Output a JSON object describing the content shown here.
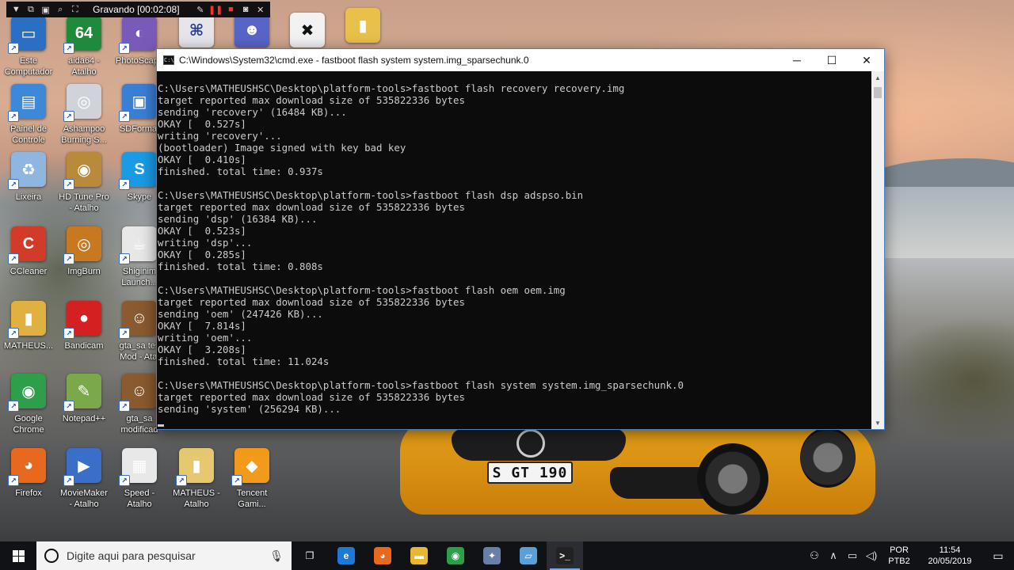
{
  "recorder": {
    "status": "Gravando [00:02:08]"
  },
  "desktop_icons": [
    {
      "id": "este-computador",
      "label": "Este\nComputador",
      "icon": "computer-icon",
      "color": "#2b6fc4",
      "glyph": "▭"
    },
    {
      "id": "aida64",
      "label": "aida64 -\nAtalho",
      "icon": "aida64-icon",
      "color": "#1f8a3a",
      "glyph": "64"
    },
    {
      "id": "photoscape",
      "label": "PhotoScape",
      "icon": "photoscape-icon",
      "color": "#7a5ab8",
      "glyph": "◐"
    },
    {
      "id": "painel",
      "label": "Painel de\nControle",
      "icon": "control-panel-icon",
      "color": "#3d88d8",
      "glyph": "▤"
    },
    {
      "id": "ashampoo",
      "label": "Ashampoo\nBurning S...",
      "icon": "ashampoo-icon",
      "color": "#d0d4da",
      "glyph": "◎"
    },
    {
      "id": "sdformat",
      "label": "SDFormat",
      "icon": "sdformatter-icon",
      "color": "#3a7fd6",
      "glyph": "▣"
    },
    {
      "id": "lixeira",
      "label": "Lixeira",
      "icon": "recycle-bin-icon",
      "color": "#8fb6de",
      "glyph": "♻"
    },
    {
      "id": "hdtune",
      "label": "HD Tune Pro\n- Atalho",
      "icon": "hdtune-icon",
      "color": "#b88a3a",
      "glyph": "◉"
    },
    {
      "id": "skype",
      "label": "Skype",
      "icon": "skype-icon",
      "color": "#1a9be6",
      "glyph": "S"
    },
    {
      "id": "ccleaner",
      "label": "CCleaner",
      "icon": "ccleaner-icon",
      "color": "#d23a2a",
      "glyph": "C"
    },
    {
      "id": "imgburn",
      "label": "ImgBurn",
      "icon": "imgburn-icon",
      "color": "#c87820",
      "glyph": "◎"
    },
    {
      "id": "shiginima",
      "label": "Shiginim\nLaunch...",
      "icon": "java-icon",
      "color": "#e8e8e8",
      "glyph": "☕"
    },
    {
      "id": "matheus1",
      "label": "MATHEUS...",
      "icon": "user-folder-icon",
      "color": "#e0b040",
      "glyph": "▮"
    },
    {
      "id": "bandicam",
      "label": "Bandicam",
      "icon": "bandicam-icon",
      "color": "#d42020",
      "glyph": "●"
    },
    {
      "id": "gtasa-test",
      "label": "gta_sa tes\nMod - Atal",
      "icon": "gta-icon",
      "color": "#8a5a30",
      "glyph": "☺"
    },
    {
      "id": "chrome",
      "label": "Google\nChrome",
      "icon": "chrome-icon",
      "color": "#2f9e4a",
      "glyph": "◉"
    },
    {
      "id": "notepadpp",
      "label": "Notepad++",
      "icon": "notepadpp-icon",
      "color": "#7aa84a",
      "glyph": "✎"
    },
    {
      "id": "gtasa-mod",
      "label": "gta_sa\nmodificad",
      "icon": "gta-icon",
      "color": "#8a5a30",
      "glyph": "☺"
    },
    {
      "id": "firefox",
      "label": "Firefox",
      "icon": "firefox-icon",
      "color": "#e8691e",
      "glyph": "◕"
    },
    {
      "id": "moviemaker",
      "label": "MovieMaker\n- Atalho",
      "icon": "moviemaker-icon",
      "color": "#3a6ec8",
      "glyph": "▶"
    },
    {
      "id": "speed",
      "label": "Speed -\nAtalho",
      "icon": "speed-icon",
      "color": "#e8e8e8",
      "glyph": "▦"
    },
    {
      "id": "matheus2",
      "label": "MATHEUS -\nAtalho",
      "icon": "folder-shortcut-icon",
      "color": "#e6c870",
      "glyph": "▮"
    },
    {
      "id": "tencent",
      "label": "Tencent\nGami...",
      "icon": "tencent-icon",
      "color": "#f29a1a",
      "glyph": "◆"
    }
  ],
  "cmd": {
    "title": "C:\\Windows\\System32\\cmd.exe - fastboot  flash system system.img_sparsechunk.0",
    "minimize_glyph": "─",
    "maximize_glyph": "☐",
    "close_glyph": "✕",
    "lines": [
      "C:\\Users\\MATHEUSHSC\\Desktop\\platform-tools>fastboot flash recovery recovery.img",
      "target reported max download size of 535822336 bytes",
      "sending 'recovery' (16484 KB)...",
      "OKAY [  0.527s]",
      "writing 'recovery'...",
      "(bootloader) Image signed with key bad key",
      "OKAY [  0.410s]",
      "finished. total time: 0.937s",
      "",
      "C:\\Users\\MATHEUSHSC\\Desktop\\platform-tools>fastboot flash dsp adspso.bin",
      "target reported max download size of 535822336 bytes",
      "sending 'dsp' (16384 KB)...",
      "OKAY [  0.523s]",
      "writing 'dsp'...",
      "OKAY [  0.285s]",
      "finished. total time: 0.808s",
      "",
      "C:\\Users\\MATHEUSHSC\\Desktop\\platform-tools>fastboot flash oem oem.img",
      "target reported max download size of 535822336 bytes",
      "sending 'oem' (247426 KB)...",
      "OKAY [  7.814s]",
      "writing 'oem'...",
      "OKAY [  3.208s]",
      "finished. total time: 11.024s",
      "",
      "C:\\Users\\MATHEUSHSC\\Desktop\\platform-tools>fastboot flash system system.img_sparsechunk.0",
      "target reported max download size of 535822336 bytes",
      "sending 'system' (256294 KB)..."
    ]
  },
  "wallpaper": {
    "plate_text": "S GT 190"
  },
  "taskbar": {
    "search_placeholder": "Digite aqui para pesquisar",
    "apps": [
      {
        "id": "task-view",
        "icon": "task-view-icon",
        "glyph": "❐",
        "color": "transparent"
      },
      {
        "id": "edge",
        "icon": "edge-icon",
        "glyph": "e",
        "color": "#1e78d6"
      },
      {
        "id": "firefox",
        "icon": "firefox-icon",
        "glyph": "◕",
        "color": "#e8691e"
      },
      {
        "id": "explorer",
        "icon": "file-explorer-icon",
        "glyph": "▬",
        "color": "#e8b830"
      },
      {
        "id": "chrome",
        "icon": "chrome-icon",
        "glyph": "◉",
        "color": "#2f9e4a"
      },
      {
        "id": "app5",
        "icon": "app-icon",
        "glyph": "✦",
        "color": "#6a7fa8"
      },
      {
        "id": "app6",
        "icon": "notes-icon",
        "glyph": "▱",
        "color": "#5aa0d8"
      },
      {
        "id": "cmd",
        "icon": "cmd-icon",
        "glyph": ">_",
        "color": "#222"
      }
    ],
    "language_line1": "POR",
    "language_line2": "PTB2",
    "time": "11:54",
    "date": "20/05/2019"
  },
  "colors": {
    "console_bg": "#0c0c0c",
    "console_text": "#cccccc",
    "taskbar_bg": "#101216",
    "window_border": "#4a7fc9"
  }
}
